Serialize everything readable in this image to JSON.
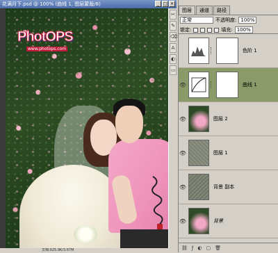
{
  "document": {
    "title": "花满月下.psd @ 100% (曲线 1, 图层蒙版/8)",
    "status": "文档:925.9K/3.67M"
  },
  "window_controls": [
    "_",
    "□",
    "×"
  ],
  "logo": {
    "main": "PhotOPS",
    "sub": "www.photops.com"
  },
  "tools": [
    "✂",
    "✎",
    "⌫",
    "A",
    "◐",
    "▭"
  ],
  "panel": {
    "tabs": [
      "图层",
      "通道",
      "路径"
    ],
    "blend_mode": "正常",
    "opacity_label": "不透明度:",
    "opacity_value": "100%",
    "lock_label": "锁定:",
    "fill_label": "填充:",
    "fill_value": "100%",
    "layers": [
      {
        "name": "色阶 1",
        "visible": false,
        "kind": "adjustment"
      },
      {
        "name": "曲线 1",
        "visible": true,
        "kind": "adjustment",
        "selected": true
      },
      {
        "name": "图层 2",
        "visible": true,
        "kind": "photo"
      },
      {
        "name": "图层 1",
        "visible": true,
        "kind": "texture"
      },
      {
        "name": "背景 副本",
        "visible": true,
        "kind": "texture"
      },
      {
        "name": "背景",
        "visible": true,
        "kind": "photo",
        "italic": true
      }
    ],
    "bottom_icons": [
      "⛓",
      "ƒ",
      "◐",
      "▢",
      "🗑"
    ]
  }
}
